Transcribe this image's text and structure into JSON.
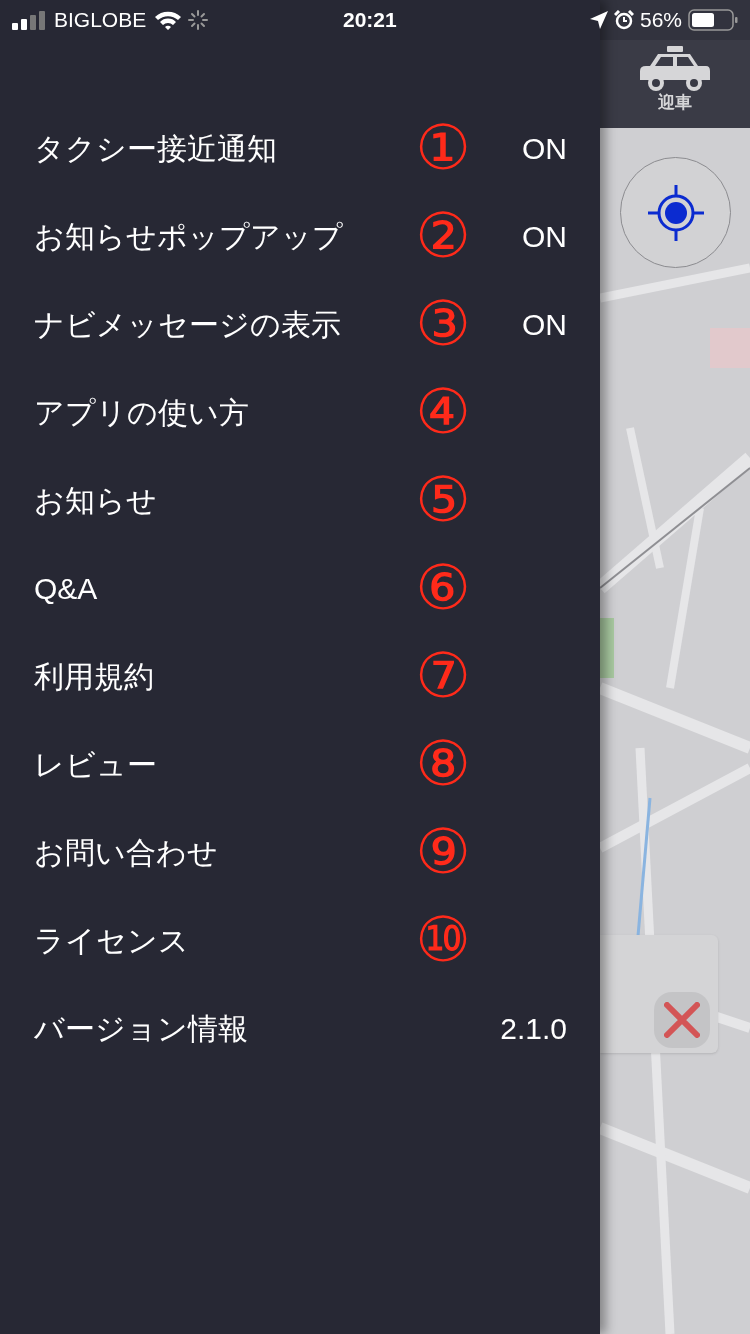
{
  "status_bar": {
    "carrier": "BIGLOBE",
    "time": "20:21",
    "battery": "56%"
  },
  "menu": {
    "items": [
      {
        "label": "タクシー接近通知",
        "annotation": "①",
        "value": "ON"
      },
      {
        "label": "お知らせポップアップ",
        "annotation": "②",
        "value": "ON"
      },
      {
        "label": "ナビメッセージの表示",
        "annotation": "③",
        "value": "ON"
      },
      {
        "label": "アプリの使い方",
        "annotation": "④"
      },
      {
        "label": "お知らせ",
        "annotation": "⑤"
      },
      {
        "label": "Q&A",
        "annotation": "⑥"
      },
      {
        "label": "利用規約",
        "annotation": "⑦"
      },
      {
        "label": "レビュー",
        "annotation": "⑧"
      },
      {
        "label": "お問い合わせ",
        "annotation": "⑨"
      },
      {
        "label": "ライセンス",
        "annotation": "⑩"
      },
      {
        "label": "バージョン情報",
        "value": "2.1.0"
      }
    ]
  },
  "map": {
    "pickup_button": {
      "label": "迎車"
    }
  }
}
